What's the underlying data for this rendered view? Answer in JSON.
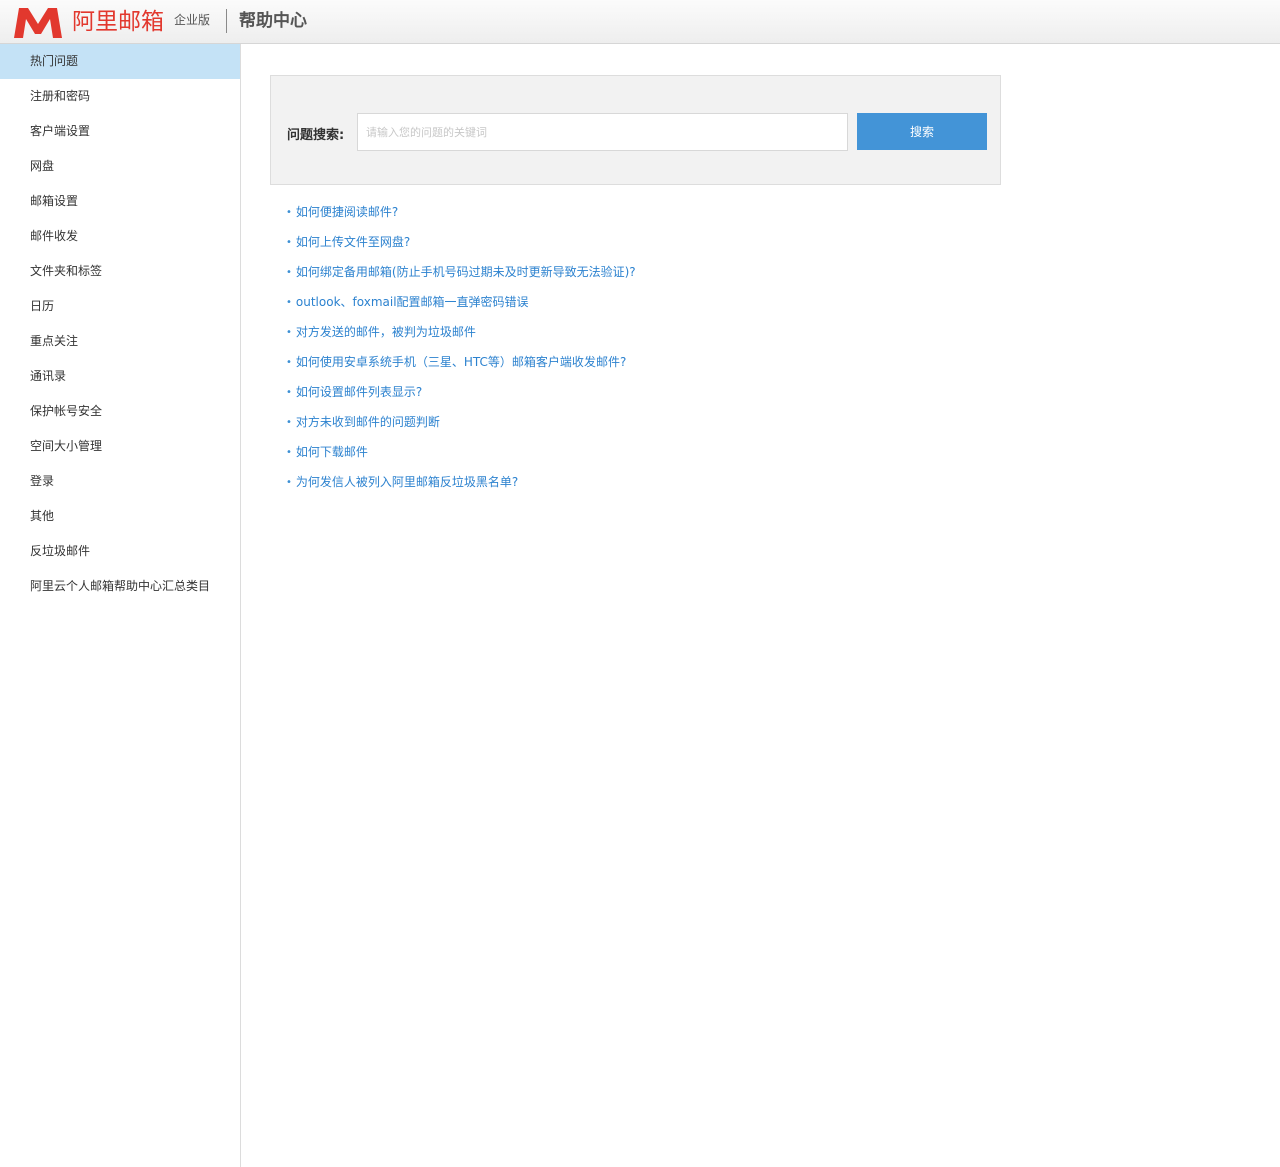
{
  "header": {
    "logo_text": "阿里邮箱",
    "edition": "企业版",
    "title": "帮助中心",
    "brand_color": "#e2382e"
  },
  "sidebar": {
    "items": [
      {
        "label": "热门问题",
        "active": true
      },
      {
        "label": "注册和密码"
      },
      {
        "label": "客户端设置"
      },
      {
        "label": "网盘"
      },
      {
        "label": "邮箱设置"
      },
      {
        "label": "邮件收发"
      },
      {
        "label": "文件夹和标签"
      },
      {
        "label": "日历"
      },
      {
        "label": "重点关注"
      },
      {
        "label": "通讯录"
      },
      {
        "label": "保护帐号安全"
      },
      {
        "label": "空间大小管理"
      },
      {
        "label": "登录"
      },
      {
        "label": "其他"
      },
      {
        "label": "反垃圾邮件"
      },
      {
        "label": "阿里云个人邮箱帮助中心汇总类目"
      }
    ]
  },
  "search": {
    "label": "问题搜索:",
    "placeholder": "请输入您的问题的关键词",
    "value": "",
    "button_label": "搜索",
    "button_color": "#4394d7"
  },
  "faq": {
    "bullet": "•",
    "items": [
      "如何便捷阅读邮件?",
      "如何上传文件至网盘?",
      "如何绑定备用邮箱(防止手机号码过期未及时更新导致无法验证)?",
      "outlook、foxmail配置邮箱一直弹密码错误",
      "对方发送的邮件，被判为垃圾邮件",
      "如何使用安卓系统手机（三星、HTC等）邮箱客户端收发邮件?",
      "如何设置邮件列表显示?",
      "对方未收到邮件的问题判断",
      "如何下载邮件",
      "为何发信人被列入阿里邮箱反垃圾黑名单?"
    ],
    "link_color": "#2c82cf"
  }
}
